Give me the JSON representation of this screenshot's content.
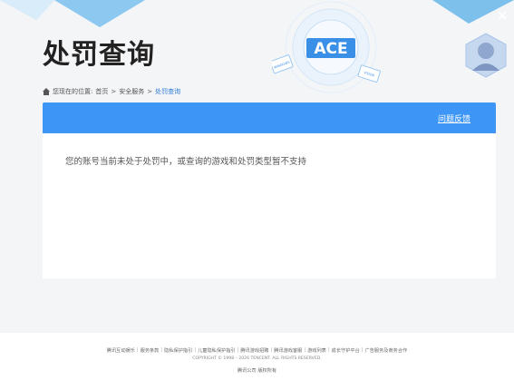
{
  "header": {
    "title": "处罚查询",
    "logo_text": "ACE",
    "badge_left": "WINDOWS",
    "badge_right": "VISION"
  },
  "breadcrumb": {
    "prefix": "您现在的位置:",
    "items": [
      "首页",
      "安全服务",
      "处罚查询"
    ],
    "separator": ">"
  },
  "panel": {
    "feedback_label": "问题反馈",
    "message": "您的账号当前未处于处罚中，或查询的游戏和处罚类型暂不支持"
  },
  "footer": {
    "links": [
      "腾讯互动娱乐",
      "服务条款",
      "隐私保护指引",
      "儿童隐私保护指引",
      "腾讯游戏招聘",
      "腾讯游戏客服",
      "游戏列表",
      "成长守护平台",
      "广告服务及商务合作"
    ],
    "copyright": "COPYRIGHT © 1998 – 2026 TENCENT. ALL RIGHTS RESERVED.",
    "company": "腾讯公司 版权所有"
  },
  "colors": {
    "accent": "#3d96f5",
    "link_current": "#2e7bd6",
    "background": "#f4f5f7"
  },
  "icons": [
    "close-icon",
    "home-icon",
    "ace-logo",
    "portrait-avatar"
  ]
}
